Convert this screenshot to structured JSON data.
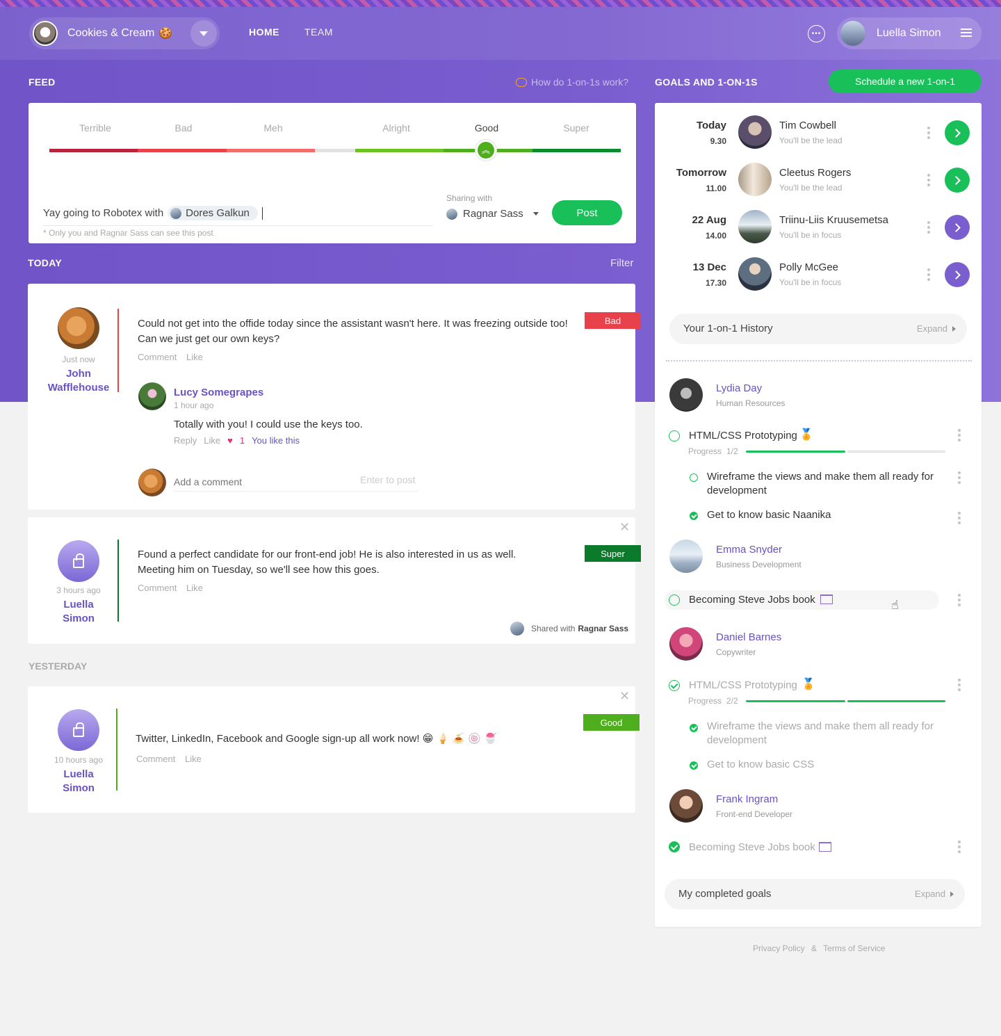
{
  "org": {
    "name": "Cookies & Cream",
    "emoji": "🍪"
  },
  "nav": {
    "home": "HOME",
    "team": "TEAM"
  },
  "user": {
    "name": "Luella Simon"
  },
  "feed": {
    "title": "FEED",
    "how_link": "How do 1-on-1s work?",
    "mood_levels": [
      "Terrible",
      "Bad",
      "Meh",
      "Alright",
      "Good",
      "Super"
    ],
    "selected_mood": "Good",
    "composer": {
      "text": "Yay going to Robotex with",
      "mention": "Dores Galkun",
      "sharing_label": "Sharing with",
      "sharing_with": "Ragnar Sass",
      "post_button": "Post",
      "note": "* Only you and Ragnar Sass can see this post"
    },
    "today_label": "TODAY",
    "filter_label": "Filter",
    "yesterday_label": "YESTERDAY",
    "posts": [
      {
        "time": "Just now",
        "author_first": "John",
        "author_last": "Wafflehouse",
        "text": "Could not get into the offide today since the assistant wasn't here. It was freezing outside too! Can we just get our own keys?",
        "mood": "Bad",
        "comment": "Comment",
        "like": "Like",
        "reply": {
          "author": "Lucy Somegrapes",
          "time": "1 hour ago",
          "text": "Totally with you! I could use the keys too.",
          "reply_label": "Reply",
          "like_label": "Like",
          "likes": "1",
          "you_like": "You like this"
        },
        "comment_placeholder": "Add a comment",
        "enter_hint": "Enter to post"
      },
      {
        "time": "3 hours ago",
        "author_first": "Luella",
        "author_last": "Simon",
        "text": "Found a perfect candidate for our front-end job! He is also interested in us as well. Meeting him on Tuesday, so we'll see how this goes.",
        "mood": "Super",
        "comment": "Comment",
        "like": "Like",
        "shared_prefix": "Shared with",
        "shared_with": "Ragnar Sass"
      },
      {
        "time": "10 hours ago",
        "author_first": "Luella",
        "author_last": "Simon",
        "text": "Twitter, LinkedIn, Facebook and Google sign-up all work now! 😁 🍦 🍝 🍥 🍧",
        "mood": "Good",
        "comment": "Comment",
        "like": "Like"
      }
    ]
  },
  "goals": {
    "title": "GOALS AND 1-ON-1S",
    "schedule_button": "Schedule a new 1-on-1",
    "meetings": [
      {
        "day": "Today",
        "time": "9.30",
        "name": "Tim Cowbell",
        "role": "You'll be the lead",
        "status_color": "#19c05a"
      },
      {
        "day": "Tomorrow",
        "time": "11.00",
        "name": "Cleetus Rogers",
        "role": "You'll be the lead",
        "status_color": "#19c05a"
      },
      {
        "day": "22 Aug",
        "time": "14.00",
        "name": "Triinu-Liis Kruusemetsa",
        "role": "You'll be in focus",
        "status_color": "#7a5dcf"
      },
      {
        "day": "13 Dec",
        "time": "17.30",
        "name": "Polly McGee",
        "role": "You'll be in focus",
        "status_color": "#7a5dcf"
      }
    ],
    "history_label": "Your 1-on-1 History",
    "expand_label": "Expand",
    "people": [
      {
        "name": "Lydia Day",
        "role": "Human Resources",
        "goal": "HTML/CSS Prototyping",
        "progress_label": "Progress",
        "progress": "1/2",
        "subgoals": [
          "Wireframe the views and make them all ready for development",
          "Get to know basic Naanika"
        ]
      },
      {
        "name": "Emma Snyder",
        "role": "Business Development",
        "goal": "Becoming Steve Jobs book"
      },
      {
        "name": "Daniel Barnes",
        "role": "Copywriter",
        "goal": "HTML/CSS Prototyping",
        "progress_label": "Progress",
        "progress": "2/2",
        "subgoals": [
          "Wireframe the views and make them all ready for development",
          "Get to know basic CSS"
        ]
      },
      {
        "name": "Frank Ingram",
        "role": "Front-end Developer",
        "goal": "Becoming Steve Jobs book"
      }
    ],
    "completed_label": "My completed goals"
  },
  "footer": {
    "privacy": "Privacy Policy",
    "amp": "&",
    "terms": "Terms of Service"
  },
  "colors": {
    "accent_purple": "#7a5dcf",
    "green": "#19c05a",
    "bad_red": "#e8414b",
    "super_green": "#0b7a2b",
    "good_green": "#4fae1e"
  }
}
